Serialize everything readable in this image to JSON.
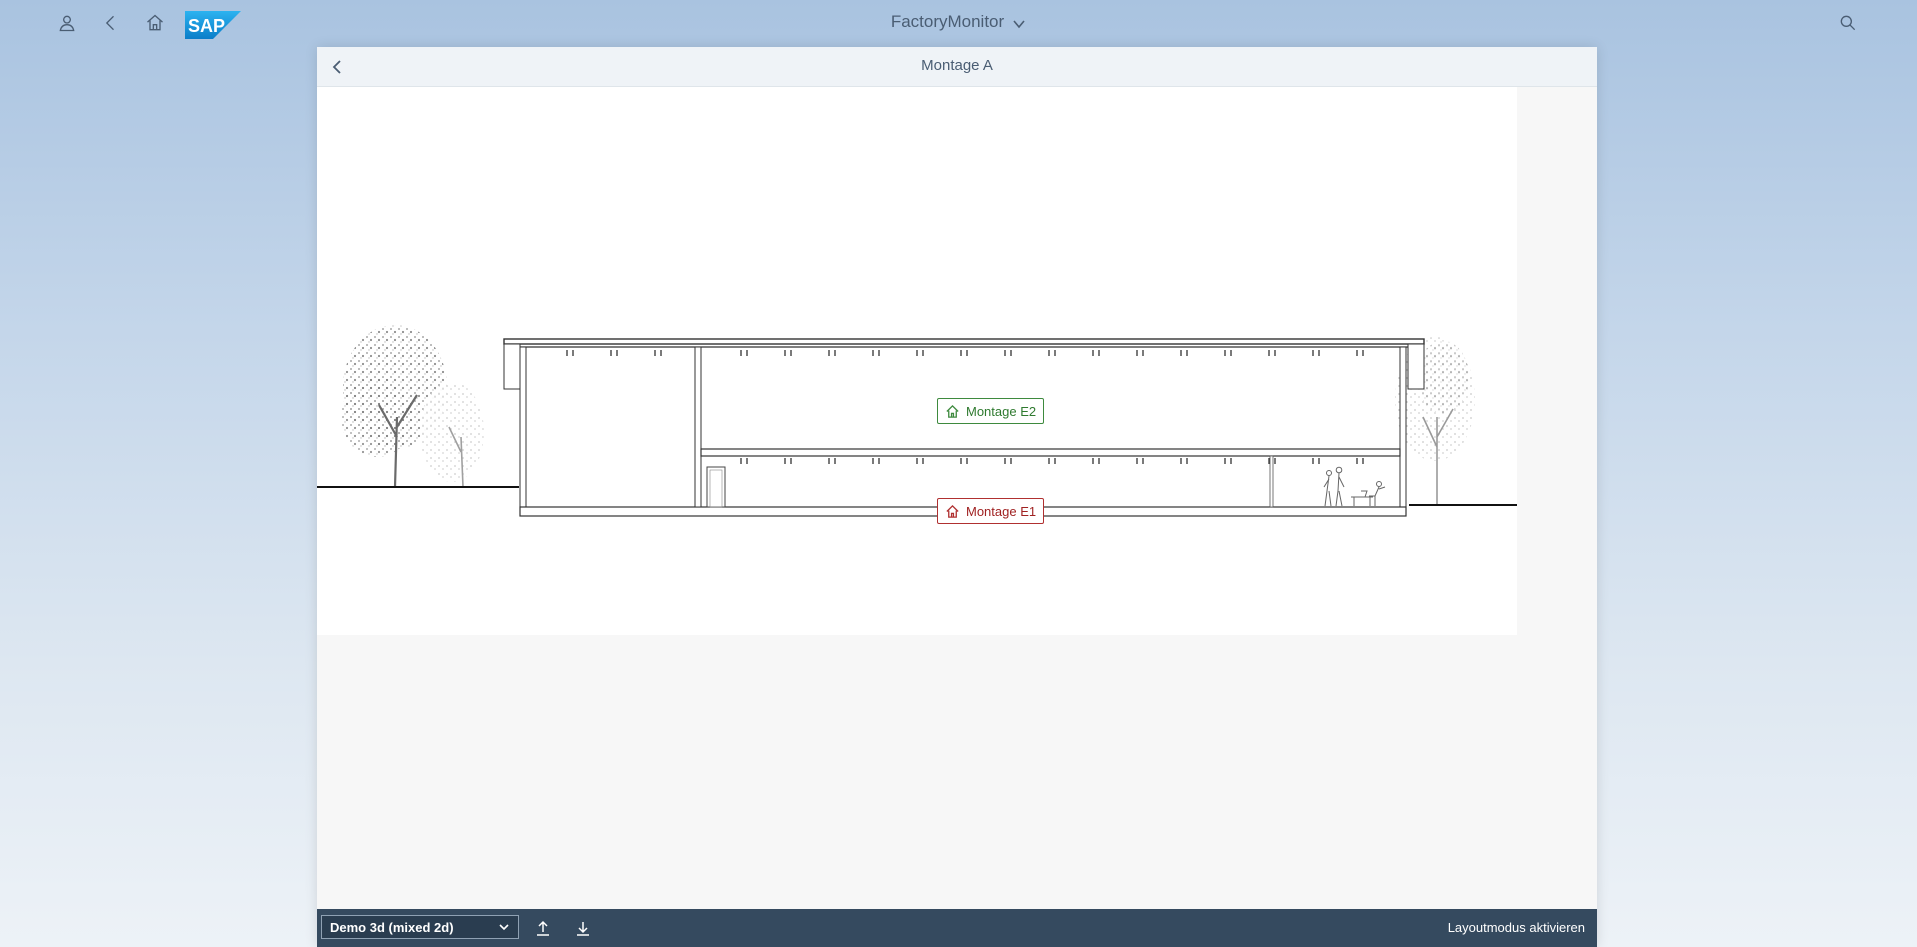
{
  "shell": {
    "app_title": "FactoryMonitor"
  },
  "page": {
    "title": "Montage A"
  },
  "floors": [
    {
      "label": "Montage E2",
      "status_color": "#3e8a3e"
    },
    {
      "label": "Montage E1",
      "status_color": "#b03030"
    }
  ],
  "footer": {
    "selected_view": "Demo 3d (mixed 2d)",
    "layout_mode_label": "Layoutmodus aktivieren"
  },
  "colors": {
    "footer_bg": "#354a5f",
    "brand": "#1a9ae0"
  }
}
